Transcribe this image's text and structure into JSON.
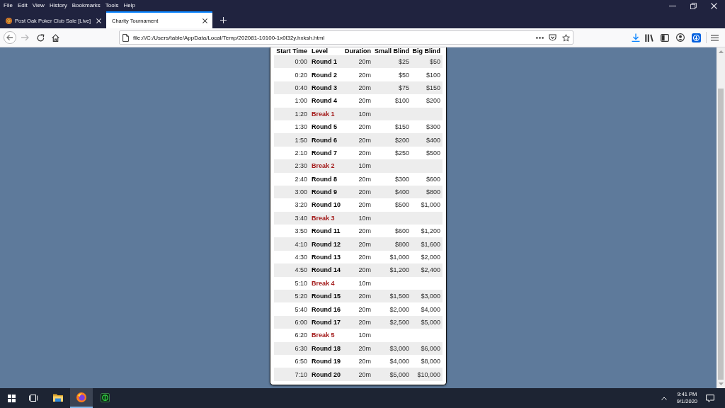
{
  "menu_bar": {
    "items": [
      "File",
      "Edit",
      "View",
      "History",
      "Bookmarks",
      "Tools",
      "Help"
    ]
  },
  "tabs": [
    {
      "title": "Post Oak Poker Club Sale [Live]",
      "favicon": true,
      "selected": false
    },
    {
      "title": "Charity Tournament",
      "favicon": false,
      "selected": true
    }
  ],
  "address_bar": {
    "url": "file:///C:/Users/table/AppData/Local/Temp/202081-10100-1x0l32y.hxksh.html"
  },
  "schedule": {
    "columns": [
      "Start Time",
      "Level",
      "Duration",
      "Small Blind",
      "Big Blind"
    ],
    "rows": [
      {
        "kind": "round",
        "start_time": "0:00",
        "level": "Round 1",
        "duration": "20m",
        "small_blind": "$25",
        "big_blind": "$50"
      },
      {
        "kind": "round",
        "start_time": "0:20",
        "level": "Round 2",
        "duration": "20m",
        "small_blind": "$50",
        "big_blind": "$100"
      },
      {
        "kind": "round",
        "start_time": "0:40",
        "level": "Round 3",
        "duration": "20m",
        "small_blind": "$75",
        "big_blind": "$150"
      },
      {
        "kind": "round",
        "start_time": "1:00",
        "level": "Round 4",
        "duration": "20m",
        "small_blind": "$100",
        "big_blind": "$200"
      },
      {
        "kind": "break",
        "start_time": "1:20",
        "level": "Break 1",
        "duration": "10m"
      },
      {
        "kind": "round",
        "start_time": "1:30",
        "level": "Round 5",
        "duration": "20m",
        "small_blind": "$150",
        "big_blind": "$300"
      },
      {
        "kind": "round",
        "start_time": "1:50",
        "level": "Round 6",
        "duration": "20m",
        "small_blind": "$200",
        "big_blind": "$400"
      },
      {
        "kind": "round",
        "start_time": "2:10",
        "level": "Round 7",
        "duration": "20m",
        "small_blind": "$250",
        "big_blind": "$500"
      },
      {
        "kind": "break",
        "start_time": "2:30",
        "level": "Break 2",
        "duration": "10m"
      },
      {
        "kind": "round",
        "start_time": "2:40",
        "level": "Round 8",
        "duration": "20m",
        "small_blind": "$300",
        "big_blind": "$600"
      },
      {
        "kind": "round",
        "start_time": "3:00",
        "level": "Round 9",
        "duration": "20m",
        "small_blind": "$400",
        "big_blind": "$800"
      },
      {
        "kind": "round",
        "start_time": "3:20",
        "level": "Round 10",
        "duration": "20m",
        "small_blind": "$500",
        "big_blind": "$1,000"
      },
      {
        "kind": "break",
        "start_time": "3:40",
        "level": "Break 3",
        "duration": "10m"
      },
      {
        "kind": "round",
        "start_time": "3:50",
        "level": "Round 11",
        "duration": "20m",
        "small_blind": "$600",
        "big_blind": "$1,200"
      },
      {
        "kind": "round",
        "start_time": "4:10",
        "level": "Round 12",
        "duration": "20m",
        "small_blind": "$800",
        "big_blind": "$1,600"
      },
      {
        "kind": "round",
        "start_time": "4:30",
        "level": "Round 13",
        "duration": "20m",
        "small_blind": "$1,000",
        "big_blind": "$2,000"
      },
      {
        "kind": "round",
        "start_time": "4:50",
        "level": "Round 14",
        "duration": "20m",
        "small_blind": "$1,200",
        "big_blind": "$2,400"
      },
      {
        "kind": "break",
        "start_time": "5:10",
        "level": "Break 4",
        "duration": "10m"
      },
      {
        "kind": "round",
        "start_time": "5:20",
        "level": "Round 15",
        "duration": "20m",
        "small_blind": "$1,500",
        "big_blind": "$3,000"
      },
      {
        "kind": "round",
        "start_time": "5:40",
        "level": "Round 16",
        "duration": "20m",
        "small_blind": "$2,000",
        "big_blind": "$4,000"
      },
      {
        "kind": "round",
        "start_time": "6:00",
        "level": "Round 17",
        "duration": "20m",
        "small_blind": "$2,500",
        "big_blind": "$5,000"
      },
      {
        "kind": "break",
        "start_time": "6:20",
        "level": "Break 5",
        "duration": "10m"
      },
      {
        "kind": "round",
        "start_time": "6:30",
        "level": "Round 18",
        "duration": "20m",
        "small_blind": "$3,000",
        "big_blind": "$6,000"
      },
      {
        "kind": "round",
        "start_time": "6:50",
        "level": "Round 19",
        "duration": "20m",
        "small_blind": "$4,000",
        "big_blind": "$8,000"
      },
      {
        "kind": "round",
        "start_time": "7:10",
        "level": "Round 20",
        "duration": "20m",
        "small_blind": "$5,000",
        "big_blind": "$10,000"
      }
    ]
  },
  "taskbar": {
    "pinned": [
      {
        "selected": false
      },
      {
        "selected": true
      },
      {
        "selected": false
      }
    ],
    "clock": {
      "time": "9:41 PM",
      "date": "9/1/2020"
    }
  }
}
